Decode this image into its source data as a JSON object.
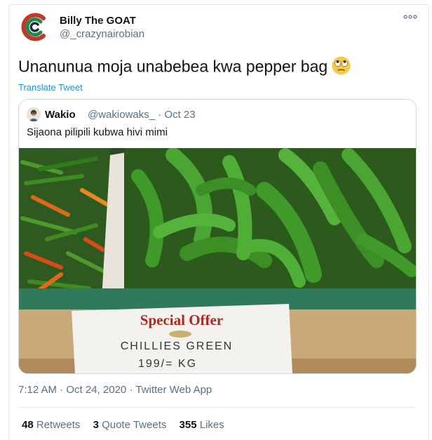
{
  "author": {
    "name": "Billy The GOAT",
    "handle": "@_crazynairobian"
  },
  "tweet": {
    "text": "Unanunua moja unabebea kwa pepper bag",
    "emoji": "face-with-rolling-eyes",
    "translate_label": "Translate Tweet"
  },
  "quoted": {
    "name": "Wakio",
    "handle": "@wakiowaks_ · Oct 23",
    "text": "Sijaona pilipili kubwa hivi mimi",
    "photo": {
      "sign_line1": "Special Offer",
      "sign_line2": "CHILLIES GREEN",
      "sign_line3": "199/= KG"
    }
  },
  "meta": {
    "time": "7:12 AM · Oct 24, 2020",
    "separator": " · ",
    "source": "Twitter Web App"
  },
  "stats": {
    "retweets_count": "48",
    "retweets_label": "Retweets",
    "quotes_count": "3",
    "quotes_label": "Quote Tweets",
    "likes_count": "355",
    "likes_label": "Likes"
  },
  "colors": {
    "link": "#1b95e0",
    "secondary_text": "#5b7083",
    "border": "#cfd9de",
    "chili_green": "#3d8b2a",
    "sign_red": "#b3261e"
  }
}
